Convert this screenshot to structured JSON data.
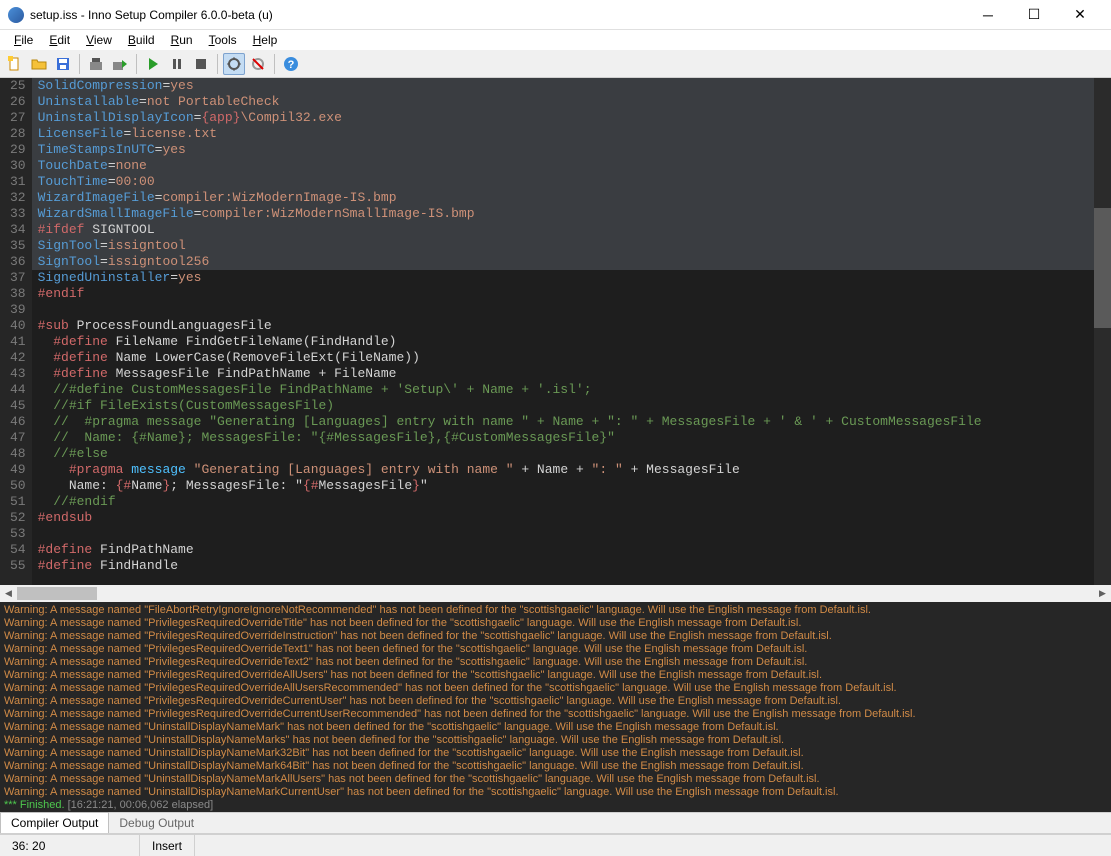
{
  "window": {
    "title": "setup.iss - Inno Setup Compiler 6.0.0-beta (u)"
  },
  "menus": [
    "File",
    "Edit",
    "View",
    "Build",
    "Run",
    "Tools",
    "Help"
  ],
  "toolbar_icons": [
    "new",
    "open",
    "save",
    "compile",
    "compile-run",
    "run",
    "stop",
    "pause",
    "step",
    "toggle1",
    "toggle2",
    "help"
  ],
  "editor": {
    "first_line": 25,
    "lines": [
      {
        "n": 25,
        "sel": true,
        "tokens": [
          [
            "prop",
            "SolidCompression"
          ],
          [
            "txt",
            "="
          ],
          [
            "val",
            "yes"
          ]
        ]
      },
      {
        "n": 26,
        "sel": true,
        "tokens": [
          [
            "prop",
            "Uninstallable"
          ],
          [
            "txt",
            "="
          ],
          [
            "val",
            "not PortableCheck"
          ]
        ]
      },
      {
        "n": 27,
        "sel": true,
        "tokens": [
          [
            "prop",
            "UninstallDisplayIcon"
          ],
          [
            "txt",
            "="
          ],
          [
            "pre",
            "{app}"
          ],
          [
            "val",
            "\\Compil32.exe"
          ]
        ]
      },
      {
        "n": 28,
        "sel": true,
        "tokens": [
          [
            "prop",
            "LicenseFile"
          ],
          [
            "txt",
            "="
          ],
          [
            "val",
            "license.txt"
          ]
        ]
      },
      {
        "n": 29,
        "sel": true,
        "tokens": [
          [
            "prop",
            "TimeStampsInUTC"
          ],
          [
            "txt",
            "="
          ],
          [
            "val",
            "yes"
          ]
        ]
      },
      {
        "n": 30,
        "sel": true,
        "tokens": [
          [
            "prop",
            "TouchDate"
          ],
          [
            "txt",
            "="
          ],
          [
            "val",
            "none"
          ]
        ]
      },
      {
        "n": 31,
        "sel": true,
        "tokens": [
          [
            "prop",
            "TouchTime"
          ],
          [
            "txt",
            "="
          ],
          [
            "val",
            "00:00"
          ]
        ]
      },
      {
        "n": 32,
        "sel": true,
        "tokens": [
          [
            "prop",
            "WizardImageFile"
          ],
          [
            "txt",
            "="
          ],
          [
            "val",
            "compiler:WizModernImage-IS.bmp"
          ]
        ]
      },
      {
        "n": 33,
        "sel": true,
        "tokens": [
          [
            "prop",
            "WizardSmallImageFile"
          ],
          [
            "txt",
            "="
          ],
          [
            "val",
            "compiler:WizModernSmallImage-IS.bmp"
          ]
        ]
      },
      {
        "n": 34,
        "sel": true,
        "tokens": [
          [
            "pre",
            "#ifdef"
          ],
          [
            "txt",
            " SIGNTOOL"
          ]
        ]
      },
      {
        "n": 35,
        "sel": true,
        "tokens": [
          [
            "prop",
            "SignTool"
          ],
          [
            "txt",
            "="
          ],
          [
            "val",
            "issigntool"
          ]
        ]
      },
      {
        "n": 36,
        "sel": true,
        "caret": true,
        "tokens": [
          [
            "prop",
            "SignTool"
          ],
          [
            "txt",
            "="
          ],
          [
            "val",
            "issigntool256"
          ]
        ]
      },
      {
        "n": 37,
        "tokens": [
          [
            "prop",
            "SignedUninstaller"
          ],
          [
            "txt",
            "="
          ],
          [
            "val",
            "yes"
          ]
        ]
      },
      {
        "n": 38,
        "tokens": [
          [
            "pre",
            "#endif"
          ]
        ]
      },
      {
        "n": 39,
        "tokens": []
      },
      {
        "n": 40,
        "tokens": [
          [
            "pre",
            "#sub"
          ],
          [
            "txt",
            " ProcessFoundLanguagesFile"
          ]
        ]
      },
      {
        "n": 41,
        "tokens": [
          [
            "txt",
            "  "
          ],
          [
            "pre",
            "#define"
          ],
          [
            "txt",
            " FileName FindGetFileName(FindHandle)"
          ]
        ]
      },
      {
        "n": 42,
        "tokens": [
          [
            "txt",
            "  "
          ],
          [
            "pre",
            "#define"
          ],
          [
            "txt",
            " Name LowerCase(RemoveFileExt(FileName))"
          ]
        ]
      },
      {
        "n": 43,
        "tokens": [
          [
            "txt",
            "  "
          ],
          [
            "pre",
            "#define"
          ],
          [
            "txt",
            " MessagesFile FindPathName + FileName"
          ]
        ]
      },
      {
        "n": 44,
        "tokens": [
          [
            "txt",
            "  "
          ],
          [
            "com",
            "//#define CustomMessagesFile FindPathName + 'Setup\\' + Name + '.isl';"
          ]
        ]
      },
      {
        "n": 45,
        "tokens": [
          [
            "txt",
            "  "
          ],
          [
            "com",
            "//#if FileExists(CustomMessagesFile)"
          ]
        ]
      },
      {
        "n": 46,
        "tokens": [
          [
            "txt",
            "  "
          ],
          [
            "com",
            "//  #pragma message \"Generating [Languages] entry with name \" + Name + \": \" + MessagesFile + ' & ' + CustomMessagesFile"
          ]
        ]
      },
      {
        "n": 47,
        "tokens": [
          [
            "txt",
            "  "
          ],
          [
            "com",
            "//  Name: {#Name}; MessagesFile: \"{#MessagesFile},{#CustomMessagesFile}\""
          ]
        ]
      },
      {
        "n": 48,
        "tokens": [
          [
            "txt",
            "  "
          ],
          [
            "com",
            "//#else"
          ]
        ]
      },
      {
        "n": 49,
        "tokens": [
          [
            "txt",
            "    "
          ],
          [
            "pre",
            "#pragma"
          ],
          [
            "txt",
            " "
          ],
          [
            "blue",
            "message"
          ],
          [
            "txt",
            " "
          ],
          [
            "str",
            "\"Generating [Languages] entry with name \""
          ],
          [
            "txt",
            " + Name + "
          ],
          [
            "str",
            "\": \""
          ],
          [
            "txt",
            " + MessagesFile"
          ]
        ]
      },
      {
        "n": 50,
        "tokens": [
          [
            "txt",
            "    Name: "
          ],
          [
            "pre",
            "{#"
          ],
          [
            "txt",
            "Name"
          ],
          [
            "pre",
            "}"
          ],
          [
            "txt",
            "; MessagesFile: \""
          ],
          [
            "pre",
            "{#"
          ],
          [
            "txt",
            "MessagesFile"
          ],
          [
            "pre",
            "}"
          ],
          [
            "txt",
            "\""
          ]
        ]
      },
      {
        "n": 51,
        "tokens": [
          [
            "txt",
            "  "
          ],
          [
            "com",
            "//#endif"
          ]
        ]
      },
      {
        "n": 52,
        "tokens": [
          [
            "pre",
            "#endsub"
          ]
        ]
      },
      {
        "n": 53,
        "tokens": []
      },
      {
        "n": 54,
        "tokens": [
          [
            "pre",
            "#define"
          ],
          [
            "txt",
            " FindPathName"
          ]
        ]
      },
      {
        "n": 55,
        "tokens": [
          [
            "pre",
            "#define"
          ],
          [
            "txt",
            " FindHandle"
          ]
        ]
      }
    ]
  },
  "output": {
    "warnings": [
      "Warning: A message named \"FileAbortRetryIgnoreIgnoreNotRecommended\" has not been defined for the \"scottishgaelic\" language. Will use the English message from Default.isl.",
      "Warning: A message named \"PrivilegesRequiredOverrideTitle\" has not been defined for the \"scottishgaelic\" language. Will use the English message from Default.isl.",
      "Warning: A message named \"PrivilegesRequiredOverrideInstruction\" has not been defined for the \"scottishgaelic\" language. Will use the English message from Default.isl.",
      "Warning: A message named \"PrivilegesRequiredOverrideText1\" has not been defined for the \"scottishgaelic\" language. Will use the English message from Default.isl.",
      "Warning: A message named \"PrivilegesRequiredOverrideText2\" has not been defined for the \"scottishgaelic\" language. Will use the English message from Default.isl.",
      "Warning: A message named \"PrivilegesRequiredOverrideAllUsers\" has not been defined for the \"scottishgaelic\" language. Will use the English message from Default.isl.",
      "Warning: A message named \"PrivilegesRequiredOverrideAllUsersRecommended\" has not been defined for the \"scottishgaelic\" language. Will use the English message from Default.isl.",
      "Warning: A message named \"PrivilegesRequiredOverrideCurrentUser\" has not been defined for the \"scottishgaelic\" language. Will use the English message from Default.isl.",
      "Warning: A message named \"PrivilegesRequiredOverrideCurrentUserRecommended\" has not been defined for the \"scottishgaelic\" language. Will use the English message from Default.isl.",
      "Warning: A message named \"UninstallDisplayNameMark\" has not been defined for the \"scottishgaelic\" language. Will use the English message from Default.isl.",
      "Warning: A message named \"UninstallDisplayNameMarks\" has not been defined for the \"scottishgaelic\" language. Will use the English message from Default.isl.",
      "Warning: A message named \"UninstallDisplayNameMark32Bit\" has not been defined for the \"scottishgaelic\" language. Will use the English message from Default.isl.",
      "Warning: A message named \"UninstallDisplayNameMark64Bit\" has not been defined for the \"scottishgaelic\" language. Will use the English message from Default.isl.",
      "Warning: A message named \"UninstallDisplayNameMarkAllUsers\" has not been defined for the \"scottishgaelic\" language. Will use the English message from Default.isl.",
      "Warning: A message named \"UninstallDisplayNameMarkCurrentUser\" has not been defined for the \"scottishgaelic\" language. Will use the English message from Default.isl."
    ],
    "finished_prefix": "*** Finished.",
    "finished_elapsed": "[16:21:21, 00:06,062 elapsed]"
  },
  "output_tabs": {
    "active": "Compiler Output",
    "inactive": "Debug Output"
  },
  "status": {
    "pos": "  36:  20",
    "mode": "Insert"
  }
}
